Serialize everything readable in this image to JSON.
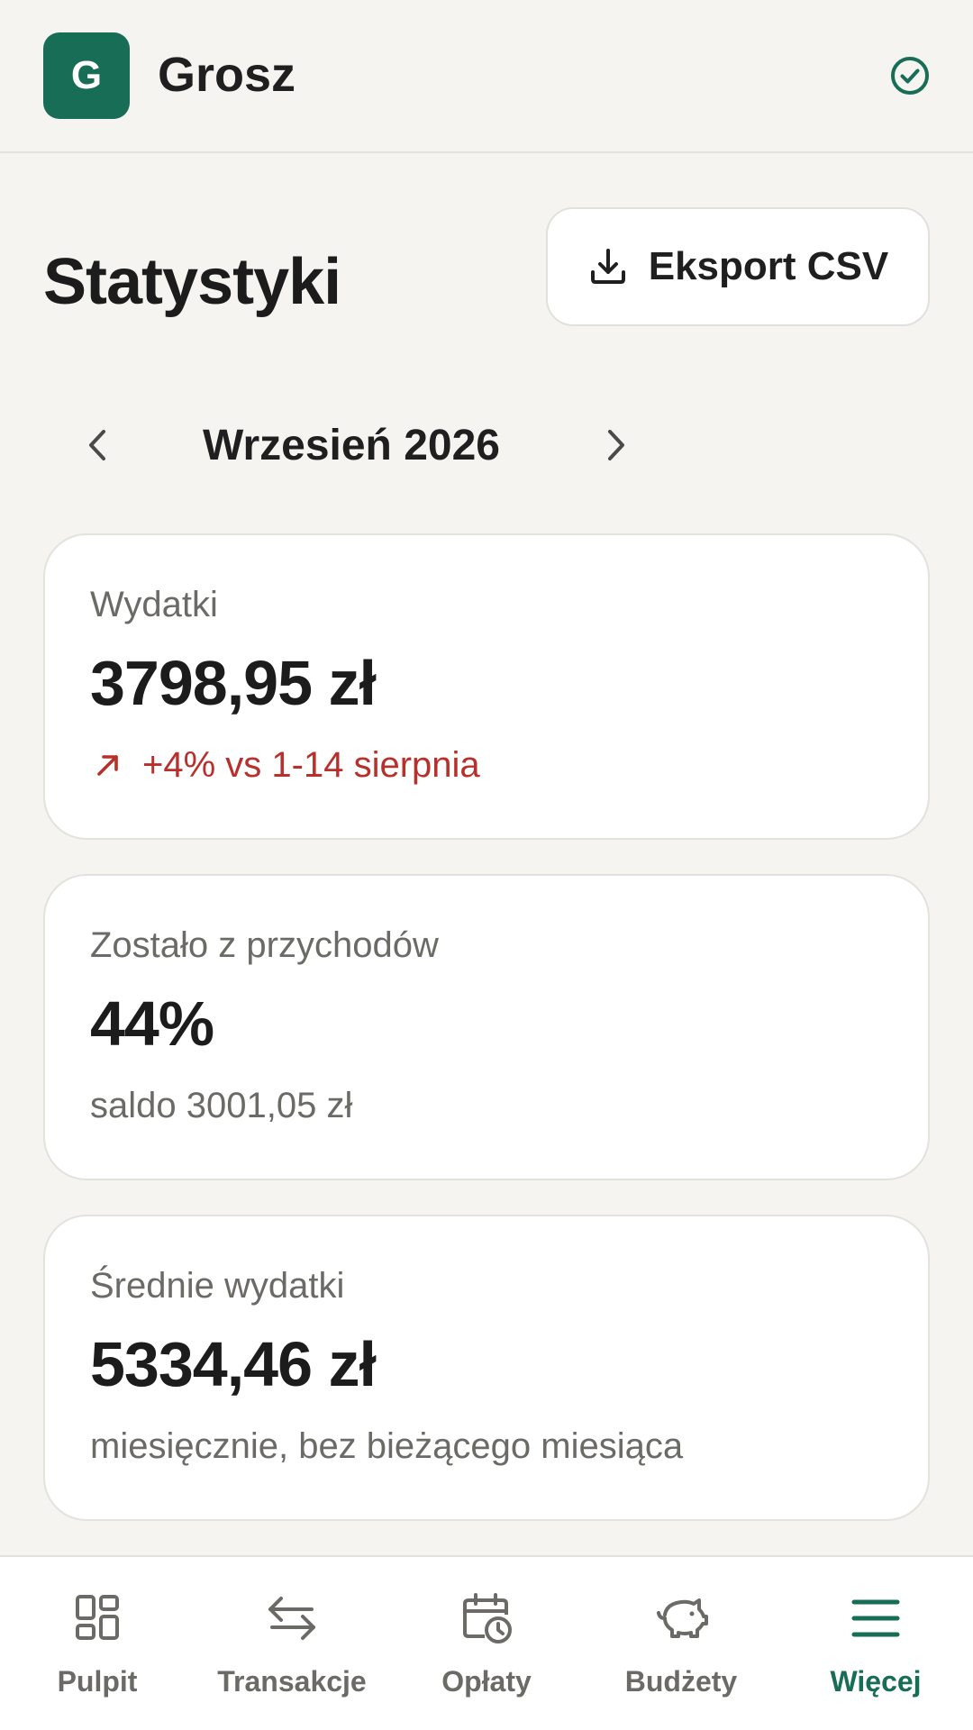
{
  "header": {
    "logo_letter": "G",
    "app_name": "Grosz",
    "status_icon": "check-circle-icon"
  },
  "page": {
    "title": "Statystyki",
    "export_label": "Eksport CSV"
  },
  "month_nav": {
    "label": "Wrzesień 2026"
  },
  "stats": [
    {
      "label": "Wydatki",
      "value": "3798,95 zł",
      "note": "+4% vs 1-14 sierpnia",
      "note_trend": "up"
    },
    {
      "label": "Zostało z przychodów",
      "value": "44%",
      "note": "saldo 3001,05 zł"
    },
    {
      "label": "Średnie wydatki",
      "value": "5334,46 zł",
      "note": "miesięcznie, bez bieżącego miesiąca"
    }
  ],
  "bottom_nav": {
    "items": [
      {
        "label": "Pulpit",
        "icon": "dashboard-icon"
      },
      {
        "label": "Transakcje",
        "icon": "transfer-arrows-icon"
      },
      {
        "label": "Opłaty",
        "icon": "calendar-clock-icon"
      },
      {
        "label": "Budżety",
        "icon": "piggy-bank-icon"
      },
      {
        "label": "Więcej",
        "icon": "menu-icon",
        "active": true
      }
    ]
  },
  "colors": {
    "brand": "#176d55",
    "trend_up": "#b8302b",
    "background": "#f5f4f1",
    "muted_text": "#6b6a66"
  }
}
